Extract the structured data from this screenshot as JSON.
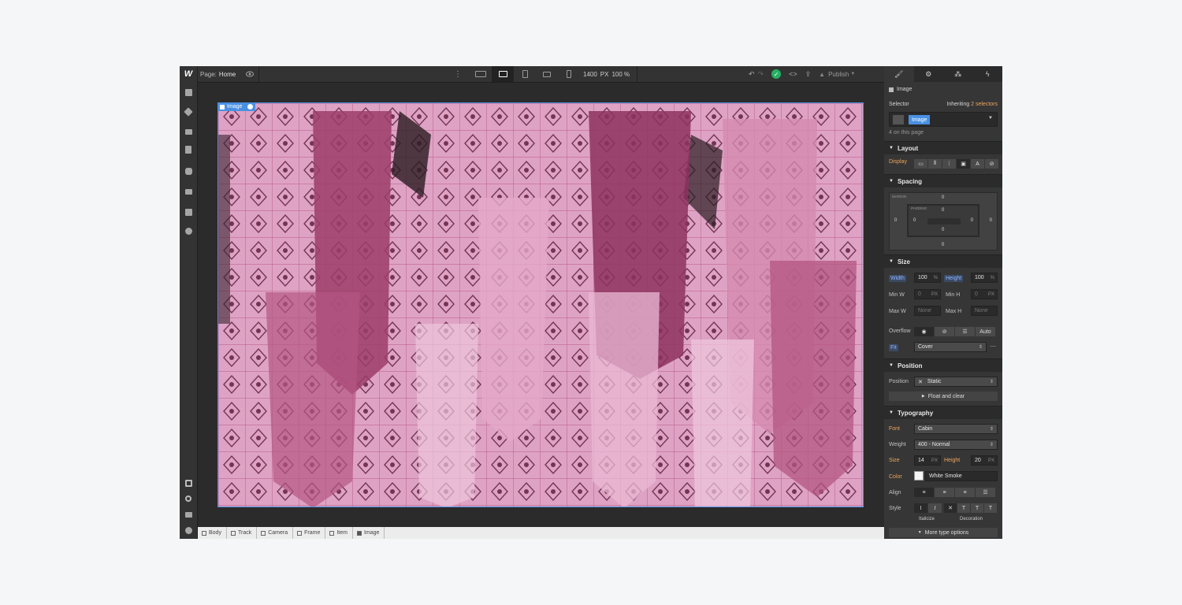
{
  "topbar": {
    "logo": "W",
    "page_prefix": "Page:",
    "page_name": "Home",
    "width_value": "1400",
    "width_unit": "PX",
    "zoom": "100 %",
    "publish_label": "Publish"
  },
  "canvas": {
    "selected_label": "Image"
  },
  "breadcrumb": [
    "Body",
    "Track",
    "Camera",
    "Frame",
    "Item",
    "Image"
  ],
  "panel": {
    "element_name": "Image",
    "selector_label": "Selector",
    "inheriting_prefix": "Inheriting",
    "inheriting_link": "2 selectors",
    "selector_chip": "Image",
    "on_page": "4 on this page",
    "layout_header": "Layout",
    "display_label": "Display",
    "spacing_header": "Spacing",
    "margin_label": "MARGIN",
    "padding_label": "PADDING",
    "margin": {
      "top": "0",
      "right": "0",
      "bottom": "0",
      "left": "0"
    },
    "padding": {
      "top": "0",
      "right": "0",
      "bottom": "0",
      "left": "0"
    },
    "size_header": "Size",
    "width_label": "Width",
    "width_value": "100",
    "width_unit": "%",
    "height_label": "Height",
    "height_value": "100",
    "height_unit": "%",
    "minw_label": "Min W",
    "minw_value": "0",
    "minw_unit": "PX",
    "minh_label": "Min H",
    "minh_value": "0",
    "minh_unit": "PX",
    "maxw_label": "Max W",
    "maxw_value": "None",
    "maxh_label": "Max H",
    "maxh_value": "None",
    "overflow_label": "Overflow",
    "overflow_auto": "Auto",
    "fit_label": "Fit",
    "fit_value": "Cover",
    "position_header": "Position",
    "position_label": "Position",
    "position_value": "Static",
    "float_label": "Float and clear",
    "typography_header": "Typography",
    "font_label": "Font",
    "font_value": "Cabin",
    "weight_label": "Weight",
    "weight_value": "400 - Normal",
    "size_label": "Size",
    "size_value": "14",
    "size_unit": "PX",
    "lineheight_label": "Height",
    "lineheight_value": "20",
    "lineheight_unit": "PX",
    "color_label": "Color",
    "color_value": "White Smoke",
    "align_label": "Align",
    "style_label": "Style",
    "italicize_label": "Italicize",
    "decoration_label": "Decoration",
    "more_type": "More type options"
  },
  "colors": {
    "accent": "#4a90e2",
    "publish_ok": "#25b063",
    "panel_bg": "#363636",
    "image_pink": "#d98fb5"
  }
}
